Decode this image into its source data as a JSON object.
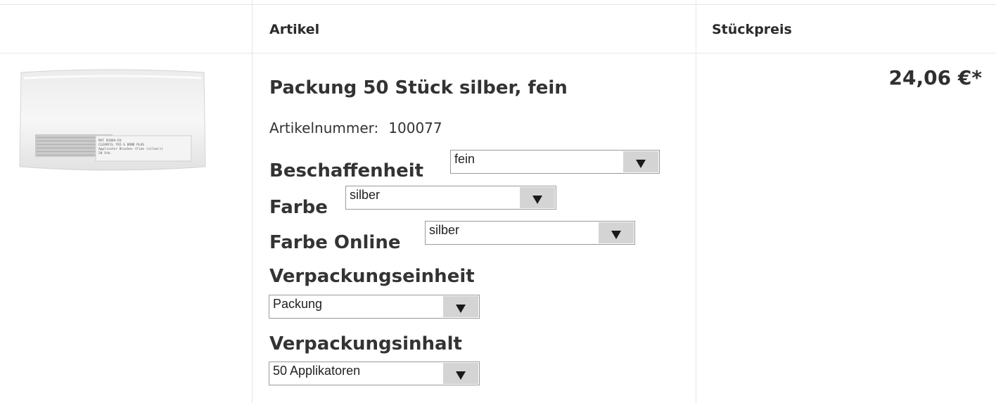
{
  "header": {
    "col_article": "Artikel",
    "col_unit_price": "Stückpreis"
  },
  "product": {
    "title": "Packung 50 Stück silber, fein",
    "article_number_label": "Artikelnummer:",
    "article_number": "100077",
    "price": "24,06 €*",
    "image_icon": "product-package-photo"
  },
  "options": {
    "beschaffenheit": {
      "label": "Beschaffenheit",
      "value": "fein"
    },
    "farbe": {
      "label": "Farbe",
      "value": "silber"
    },
    "farbe_online": {
      "label": "Farbe Online",
      "value": "silber"
    },
    "verpackungseinheit": {
      "label": "Verpackungseinheit",
      "value": "Packung"
    },
    "verpackungsinhalt": {
      "label": "Verpackungsinhalt",
      "value": "50 Applikatoren"
    }
  },
  "package_print": {
    "line1": "REF 81004-EU",
    "line2": "CLEARFIL TRI-S BOND PLUS",
    "line3": "Applicator Brushes (Fine (silver))",
    "line4": "50 Stk."
  }
}
